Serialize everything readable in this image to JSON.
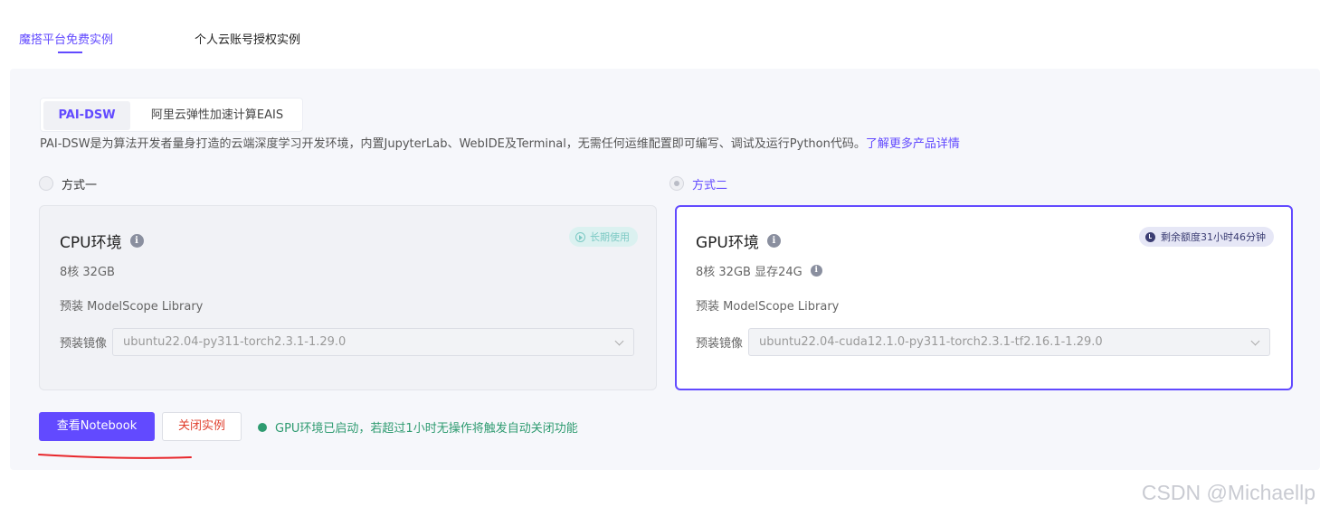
{
  "top_tabs": {
    "items": [
      {
        "label": "魔搭平台免费实例",
        "active": true
      },
      {
        "label": "个人云账号授权实例",
        "active": false
      }
    ]
  },
  "segment": {
    "items": [
      {
        "label": "PAI-DSW",
        "active": true
      },
      {
        "label": "阿里云弹性加速计算EAIS",
        "active": false
      }
    ]
  },
  "description": {
    "text": "PAI-DSW是为算法开发者量身打造的云端深度学习开发环境，内置JupyterLab、WebIDE及Terminal，无需任何运维配置即可编写、调试及运行Python代码。",
    "link": "了解更多产品详情"
  },
  "options": {
    "one": {
      "label": "方式一",
      "checked": false
    },
    "two": {
      "label": "方式二",
      "checked": true
    }
  },
  "cpu_card": {
    "title": "CPU环境",
    "badge": "长期使用",
    "spec": "8核 32GB",
    "preinstall": "预装 ModelScope Library",
    "image_label": "预装镜像",
    "image_value": "ubuntu22.04-py311-torch2.3.1-1.29.0"
  },
  "gpu_card": {
    "title": "GPU环境",
    "badge": "剩余额度31小时46分钟",
    "spec": "8核 32GB 显存24G",
    "preinstall": "预装 ModelScope Library",
    "image_label": "预装镜像",
    "image_value": "ubuntu22.04-cuda12.1.0-py311-torch2.3.1-tf2.16.1-1.29.0"
  },
  "actions": {
    "view_notebook": "查看Notebook",
    "close_instance": "关闭实例",
    "status": "GPU环境已启动，若超过1小时无操作将触发自动关闭功能"
  },
  "watermark": "CSDN @Michaellp",
  "colors": {
    "accent": "#624aff",
    "danger": "#e0402f",
    "success": "#2e9b70",
    "annotation": "#e8262b"
  }
}
